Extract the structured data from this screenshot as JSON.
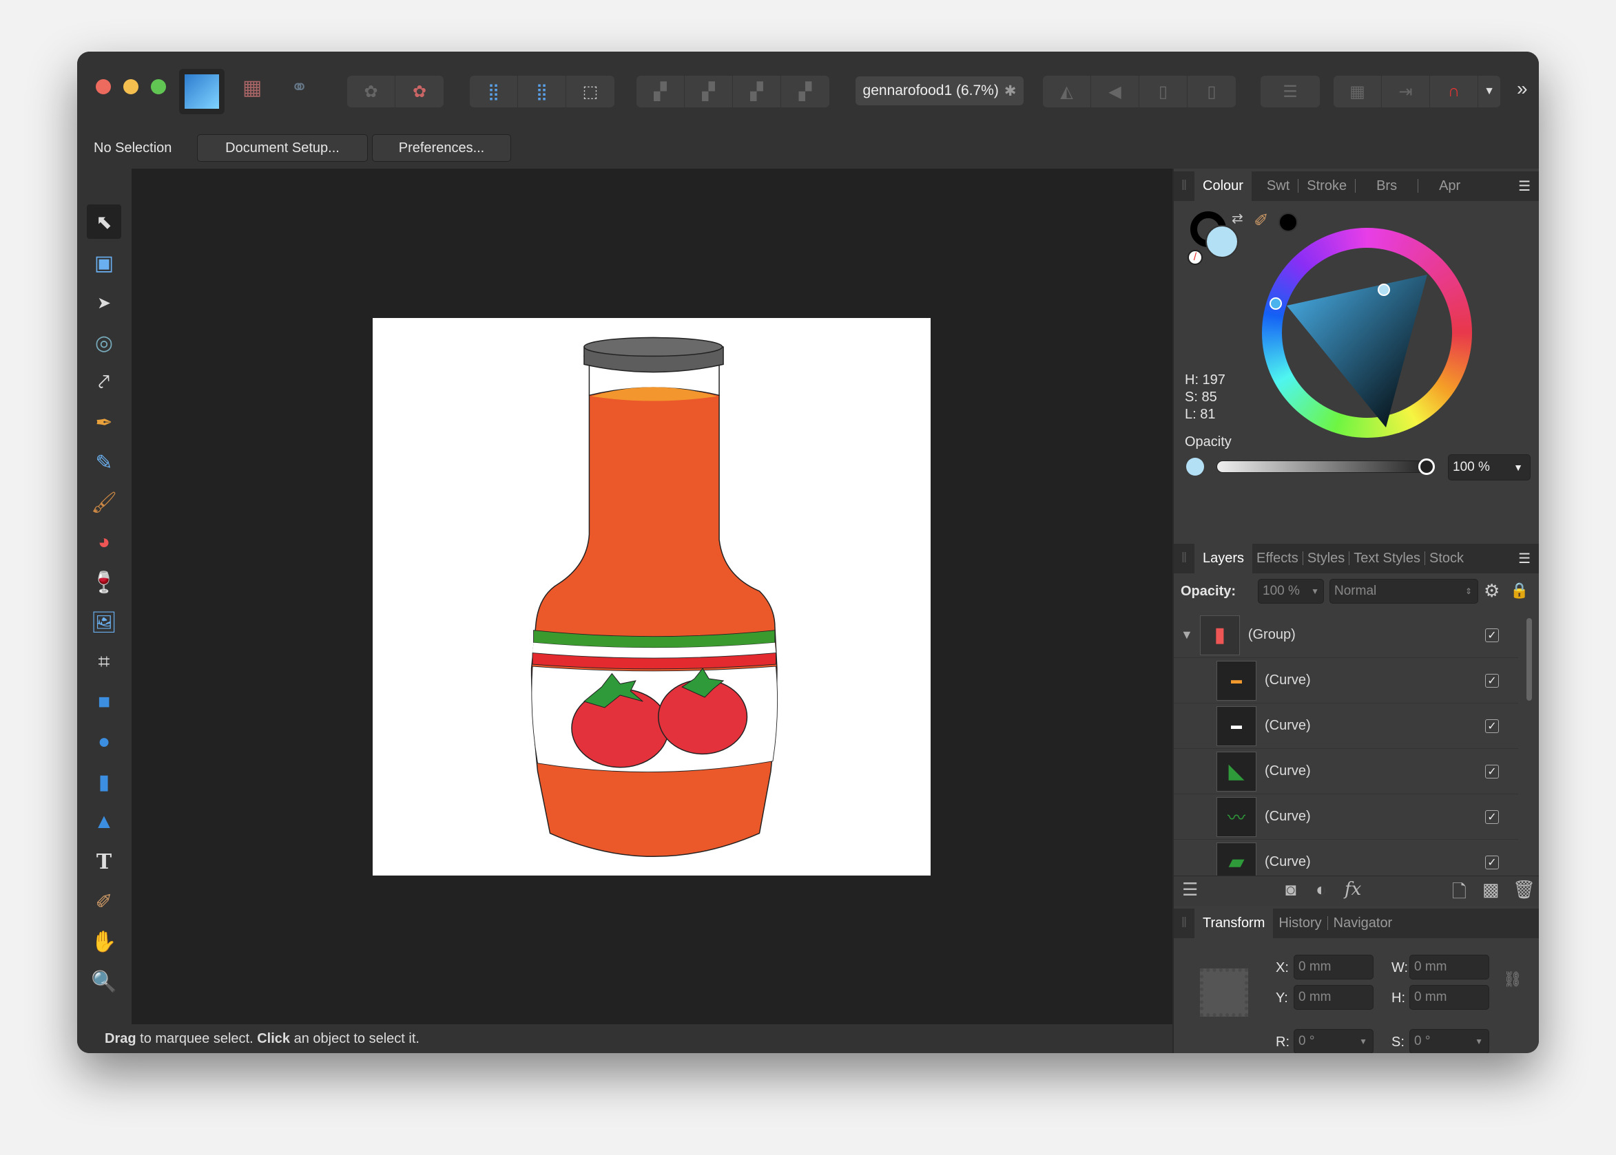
{
  "toolbar": {
    "document_title": "gennarofood1 (6.7%)",
    "overflow": "»"
  },
  "context": {
    "selection": "No Selection",
    "document_setup": "Document Setup...",
    "preferences": "Preferences..."
  },
  "colour_panel": {
    "tabs": [
      "Colour",
      "Swt",
      "Stroke",
      "Brs",
      "Apr"
    ],
    "h": "H: 197",
    "s": "S: 85",
    "l": "L: 81",
    "opacity_label": "Opacity",
    "opacity_value": "100 %",
    "fill_color": "#b3e0f5",
    "opacity_fraction": 1.0
  },
  "layers_panel": {
    "tabs": [
      "Layers",
      "Effects",
      "Styles",
      "Text Styles",
      "Stock"
    ],
    "opacity_label": "Opacity:",
    "opacity_value": "100 %",
    "blend_mode": "Normal",
    "layers": [
      {
        "name": "(Group)",
        "visible": true
      },
      {
        "name": "(Curve)",
        "visible": true
      },
      {
        "name": "(Curve)",
        "visible": true
      },
      {
        "name": "(Curve)",
        "visible": true
      },
      {
        "name": "(Curve)",
        "visible": true
      },
      {
        "name": "(Curve)",
        "visible": true
      }
    ]
  },
  "transform_panel": {
    "tabs": [
      "Transform",
      "History",
      "Navigator"
    ],
    "x_label": "X:",
    "x": "0 mm",
    "y_label": "Y:",
    "y": "0 mm",
    "w_label": "W:",
    "w": "0 mm",
    "h_label": "H:",
    "h": "0 mm",
    "r_label": "R:",
    "r": "0 °",
    "s_label": "S:",
    "s": "0 °"
  },
  "status": {
    "drag": "Drag",
    "drag_text": " to marquee select. ",
    "click": "Click",
    "click_text": " an object to select it."
  }
}
